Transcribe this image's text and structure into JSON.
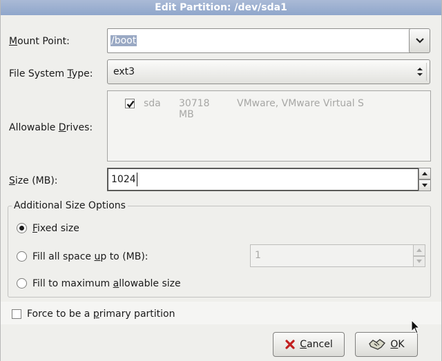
{
  "window": {
    "title": "Edit Partition: /dev/sda1"
  },
  "mount_point": {
    "label": "ount Point:",
    "mnemonic": "M",
    "value": "/boot"
  },
  "fs_type": {
    "label_pre": "File System ",
    "mnemonic": "T",
    "label_post": "ype:",
    "value": "ext3"
  },
  "drives": {
    "label_pre": "Allowable ",
    "mnemonic": "D",
    "label_post": "rives:",
    "items": [
      {
        "name": "sda",
        "size": "30718 MB",
        "model": "VMware, VMware Virtual S",
        "checked": true
      }
    ]
  },
  "size": {
    "mnemonic": "S",
    "label_post": "ize (MB):",
    "value": "1024"
  },
  "options": {
    "legend": "Additional Size Options",
    "fixed": {
      "mnemonic": "F",
      "label_post": "ixed size",
      "selected": true
    },
    "fill_upto": {
      "label_pre": "Fill all space ",
      "mnemonic": "u",
      "label_post": "p to (MB):",
      "value": "1",
      "selected": false
    },
    "fill_max": {
      "label_pre": "Fill to maximum ",
      "mnemonic": "a",
      "label_post": "llowable size",
      "selected": false
    }
  },
  "primary": {
    "label_pre": "Force to be a ",
    "mnemonic": "p",
    "label_post": "rimary partition",
    "checked": false
  },
  "buttons": {
    "cancel": {
      "mnemonic": "C",
      "label_post": "ancel"
    },
    "ok": {
      "mnemonic": "O",
      "label_post": "K"
    }
  },
  "colors": {
    "title_bar": "#96abce",
    "selection": "#9aa9c4",
    "disabled_text": "#a7a7a5"
  }
}
